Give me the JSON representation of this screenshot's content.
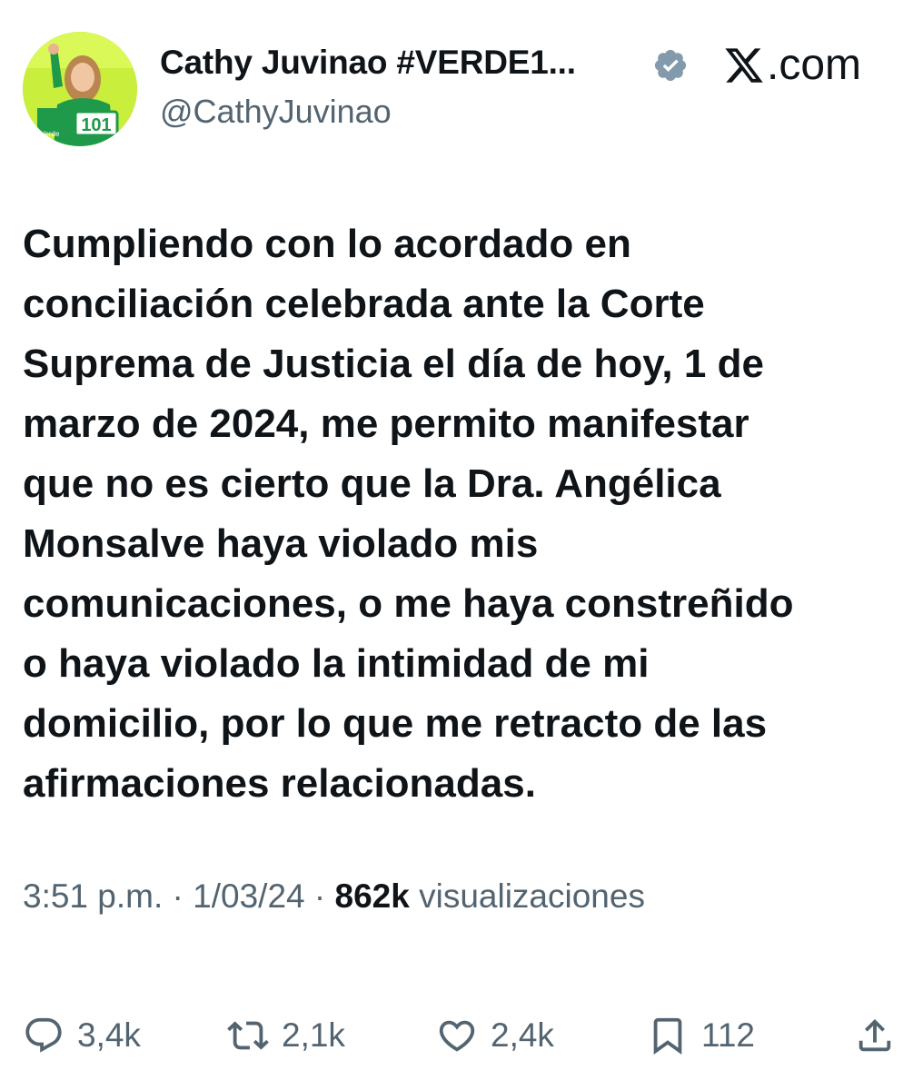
{
  "author": {
    "display_name": "Cathy Juvinao #VERDE1...",
    "handle": "@CathyJuvinao",
    "avatar_badge": "101",
    "avatar_party": "Verde"
  },
  "brand": {
    "label": ".com"
  },
  "tweet": {
    "lines": [
      "Cumpliendo con lo acordado en",
      "conciliación celebrada ante la Corte",
      "Suprema de Justicia el día de hoy, 1 de",
      "marzo de 2024, me permito manifestar",
      "que no es cierto que la Dra. Angélica",
      "Monsalve haya violado mis",
      "comunicaciones, o me haya constreñido",
      "o haya violado la intimidad de mi",
      "domicilio, por lo que me retracto de las",
      "afirmaciones relacionadas."
    ]
  },
  "meta": {
    "time": "3:51 p.m.",
    "separator": " · ",
    "date": "1/03/24",
    "views_count": "862k",
    "views_label": " visualizaciones"
  },
  "actions": {
    "replies": "3,4k",
    "reposts": "2,1k",
    "likes": "2,4k",
    "bookmarks": "112"
  },
  "colors": {
    "text_primary": "#0f1419",
    "text_secondary": "#536471",
    "avatar_bg": "#c8ee3a",
    "avatar_jacket": "#1f9a4a"
  },
  "icons": [
    "verified-badge-icon",
    "x-logo-icon",
    "reply-icon",
    "repost-icon",
    "like-icon",
    "bookmark-icon",
    "share-icon"
  ]
}
